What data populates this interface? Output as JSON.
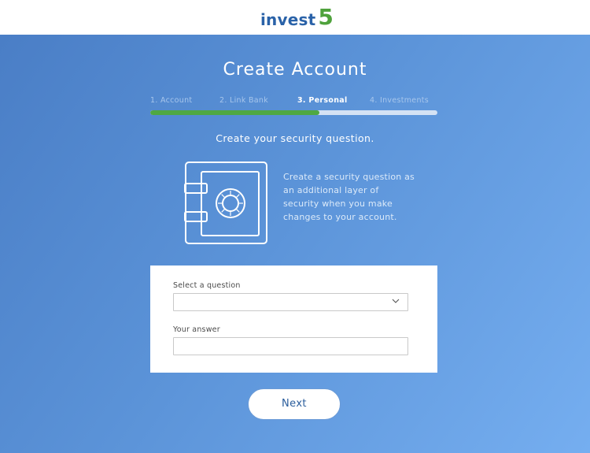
{
  "header": {
    "logo_text": "invest",
    "logo_number": "5"
  },
  "page": {
    "title": "Create Account",
    "subtitle": "Create your security question.",
    "description": "Create a security question as an additional layer of security when you make changes to your account."
  },
  "steps": {
    "items": [
      {
        "label": "1. Account",
        "state": "completed"
      },
      {
        "label": "2. Link Bank",
        "state": "completed"
      },
      {
        "label": "3. Personal",
        "state": "active"
      },
      {
        "label": "4. Investments",
        "state": "upcoming"
      }
    ],
    "progress_percent": 59
  },
  "form": {
    "question_label": "Select a question",
    "question_value": "",
    "answer_label": "Your answer",
    "answer_value": ""
  },
  "actions": {
    "next_label": "Next"
  },
  "colors": {
    "brand_blue": "#2a62a8",
    "brand_green": "#4fa23c",
    "progress_fill": "#4fa843",
    "background_start": "#4a7ec6",
    "background_end": "#75aef0"
  },
  "icons": {
    "logo": "invest5-logo",
    "illustration": "safe-icon",
    "select_arrow": "chevron-down-icon"
  }
}
